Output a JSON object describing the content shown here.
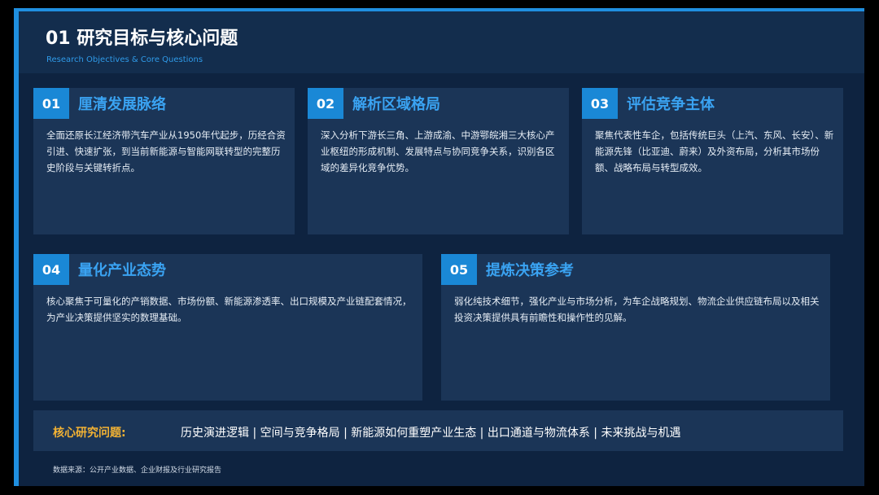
{
  "header": {
    "title": "01 研究目标与核心问题",
    "subtitle": "Research Objectives & Core Questions"
  },
  "cards": [
    {
      "number": "01",
      "title": "厘清发展脉络",
      "text": "全面还原长江经济带汽车产业从1950年代起步，历经合资引进、快速扩张，到当前新能源与智能网联转型的完整历史阶段与关键转折点。"
    },
    {
      "number": "02",
      "title": "解析区域格局",
      "text": "深入分析下游长三角、上游成渝、中游鄂皖湘三大核心产业枢纽的形成机制、发展特点与协同竞争关系，识别各区域的差异化竞争优势。"
    },
    {
      "number": "03",
      "title": "评估竞争主体",
      "text": "聚焦代表性车企，包括传统巨头（上汽、东风、长安）、新能源先锋（比亚迪、蔚来）及外资布局，分析其市场份额、战略布局与转型成效。"
    },
    {
      "number": "04",
      "title": "量化产业态势",
      "text": "核心聚焦于可量化的产销数据、市场份额、新能源渗透率、出口规模及产业链配套情况，为产业决策提供坚实的数理基础。"
    },
    {
      "number": "05",
      "title": "提炼决策参考",
      "text": "弱化纯技术细节，强化产业与市场分析，为车企战略规划、物流企业供应链布局以及相关投资决策提供具有前瞻性和操作性的见解。"
    }
  ],
  "core": {
    "label": "核心研究问题:",
    "text": "历史演进逻辑 | 空间与竞争格局 | 新能源如何重塑产业生态 | 出口通道与物流体系 | 未来挑战与机遇"
  },
  "footer": {
    "source": "数据来源：公开产业数据、企业财报及行业研究报告"
  },
  "colors": {
    "background": "#0e2340",
    "card": "#1b3557",
    "accent": "#1a88d6",
    "card_title": "#3aa3f2",
    "core_label": "#f2b234"
  }
}
